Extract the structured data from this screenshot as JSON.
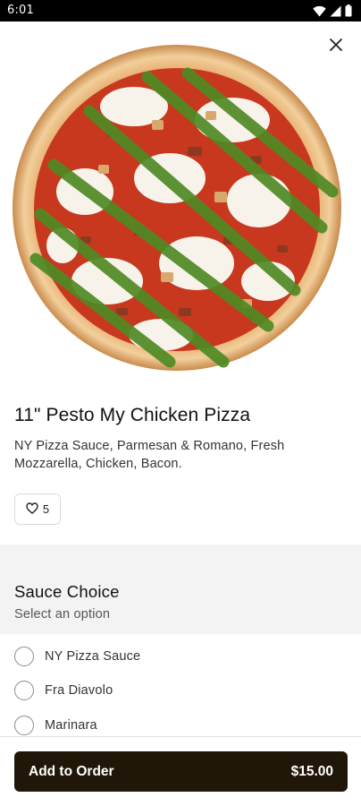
{
  "status": {
    "time": "6:01"
  },
  "product": {
    "title": "11\" Pesto My Chicken Pizza",
    "description": "NY Pizza Sauce, Parmesan & Romano, Fresh Mozzarella, Chicken, Bacon.",
    "likes": "5"
  },
  "options_section": {
    "title": "Sauce Choice",
    "subtitle": "Select an option",
    "items": [
      {
        "label": "NY Pizza Sauce",
        "selected": false
      },
      {
        "label": "Fra Diavolo",
        "selected": false
      },
      {
        "label": "Marinara",
        "selected": false
      }
    ]
  },
  "footer": {
    "button_label": "Add to Order",
    "price": "$15.00"
  },
  "colors": {
    "button_bg": "#211708",
    "section_bg": "#f3f3f3"
  },
  "icons": [
    "wifi-icon",
    "signal-icon",
    "battery-icon",
    "close-icon",
    "heart-icon"
  ]
}
